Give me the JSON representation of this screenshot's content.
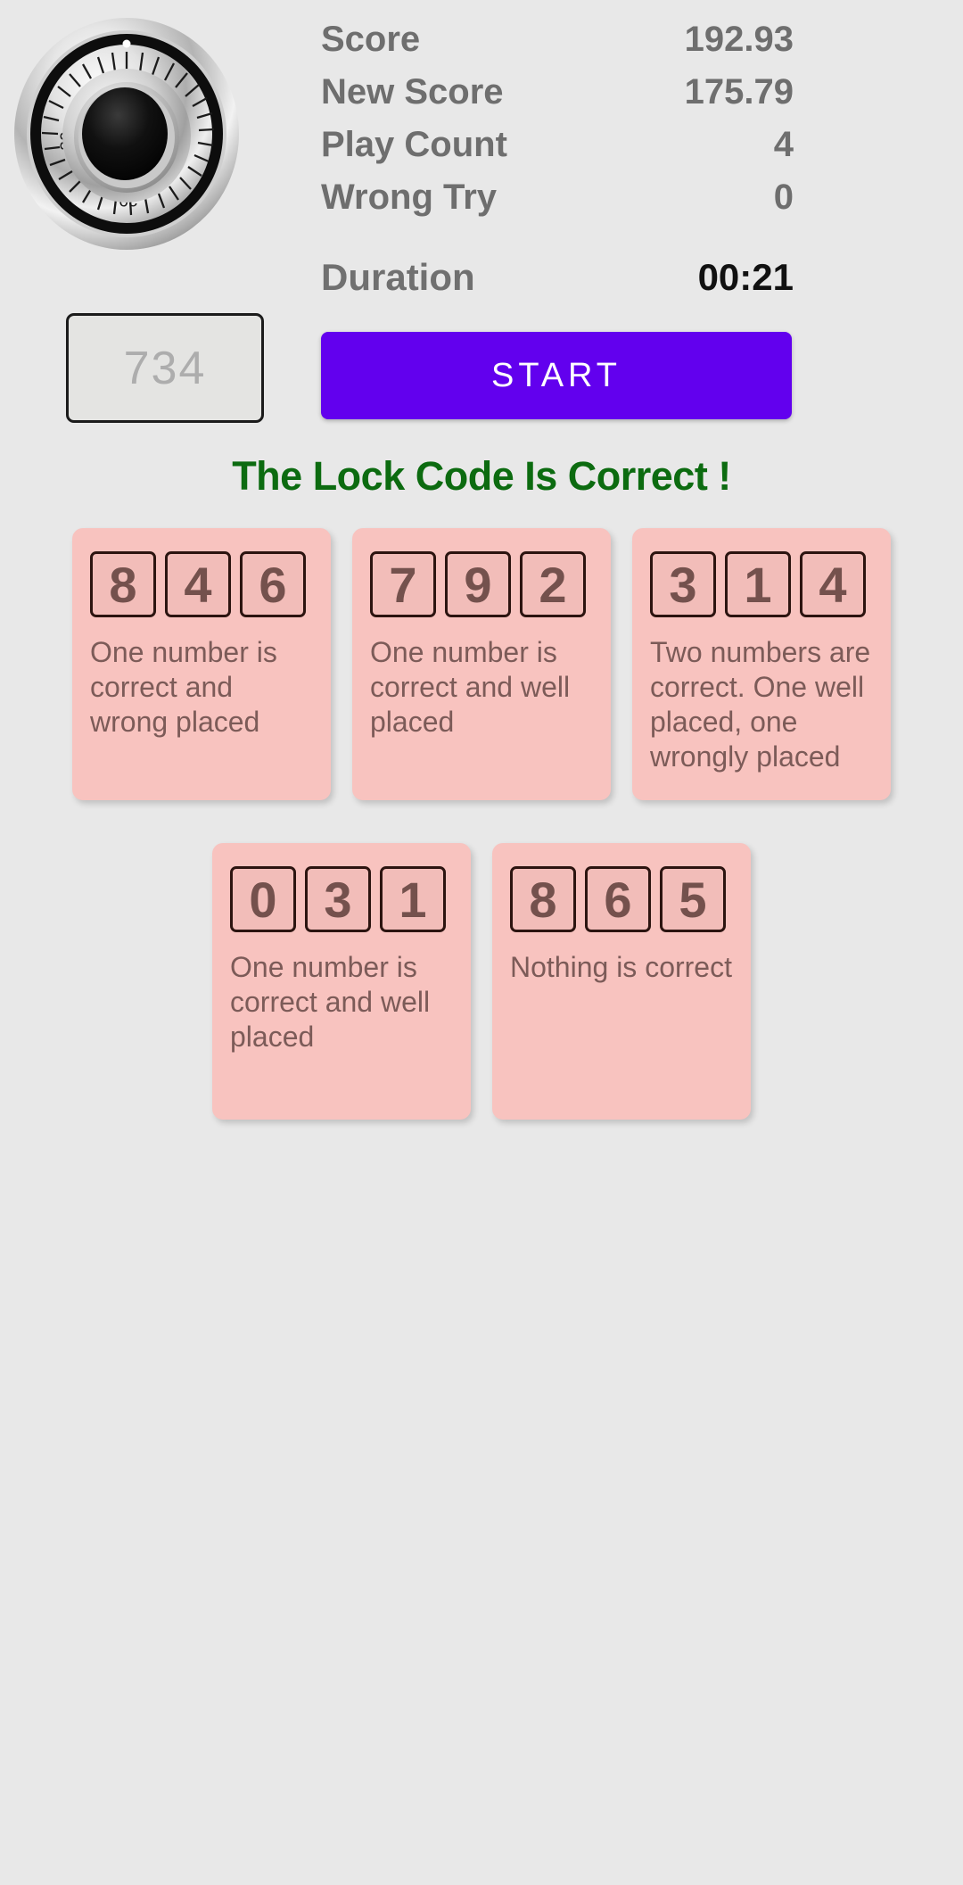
{
  "stats": {
    "rows": [
      {
        "label": "Score",
        "value": "192.93"
      },
      {
        "label": "New Score",
        "value": "175.79"
      },
      {
        "label": "Play Count",
        "value": "4"
      },
      {
        "label": "Wrong Try",
        "value": "0"
      }
    ],
    "duration": {
      "label": "Duration",
      "value": "00:21"
    }
  },
  "dial": {
    "icon": "combination-lock-dial",
    "tick_labels": [
      "0",
      "10",
      "20",
      "30"
    ]
  },
  "entry": {
    "input_value": "734",
    "input_placeholder": "734",
    "start_label": "START",
    "start_color": "#6200ee"
  },
  "result": {
    "message": "The Lock Code Is Correct !",
    "color": "#0c6b10"
  },
  "hints": {
    "card_color": "#f8c3bf",
    "digit_box_color": "#f2bdb9",
    "text_color": "#7c5b58",
    "row1": [
      {
        "digits": [
          "8",
          "4",
          "6"
        ],
        "text": "One number is correct and wrong placed"
      },
      {
        "digits": [
          "7",
          "9",
          "2"
        ],
        "text": "One number is correct and well placed"
      },
      {
        "digits": [
          "3",
          "1",
          "4"
        ],
        "text": "Two numbers are correct. One well placed, one wrongly placed"
      }
    ],
    "row2": [
      {
        "digits": [
          "0",
          "3",
          "1"
        ],
        "text": "One number is correct and well placed"
      },
      {
        "digits": [
          "8",
          "6",
          "5"
        ],
        "text": "Nothing is correct"
      }
    ]
  }
}
